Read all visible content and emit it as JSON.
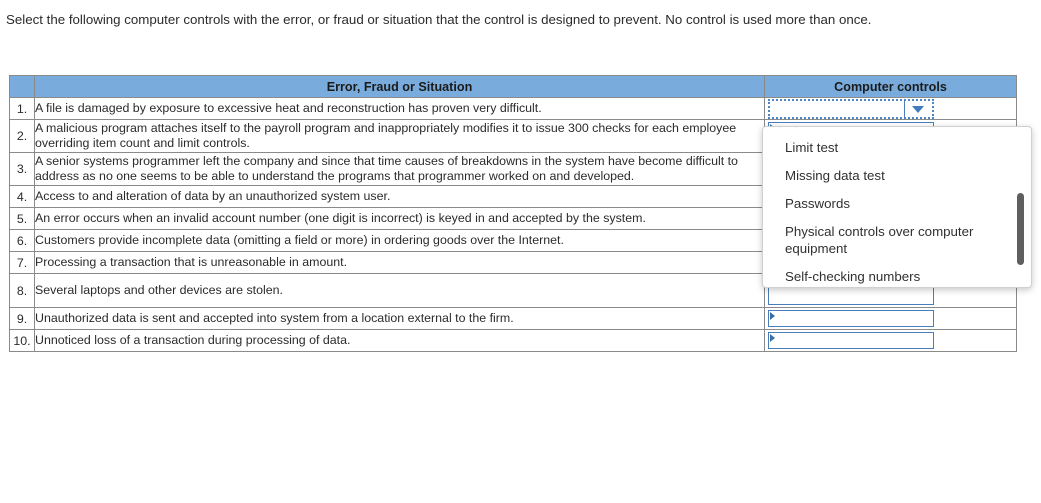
{
  "prompt": {
    "text": "Select the following computer controls with the error, or fraud or situation that the control is designed to prevent. No control is used more than once."
  },
  "table": {
    "headers": {
      "number": "",
      "situation": "Error, Fraud or Situation",
      "controls": "Computer controls"
    },
    "rows": [
      {
        "num": "1.",
        "situation": "A file is damaged by exposure to excessive heat and reconstruction has proven very difficult.",
        "control_value": ""
      },
      {
        "num": "2.",
        "situation": "A malicious program attaches itself to the payroll program and inappropriately modifies it to issue 300 checks for each employee overriding item count and limit controls.",
        "control_value": ""
      },
      {
        "num": "3.",
        "situation": "A senior systems programmer left the company and since that time causes of breakdowns in the system have become difficult to address as no one seems to be able to understand the programs that programmer worked on and developed.",
        "control_value": ""
      },
      {
        "num": "4.",
        "situation": "Access to and alteration of data by an unauthorized system user.",
        "control_value": ""
      },
      {
        "num": "5.",
        "situation": "An error occurs when an invalid account number (one digit is incorrect) is keyed in and accepted by the system.",
        "control_value": ""
      },
      {
        "num": "6.",
        "situation": "Customers provide incomplete data (omitting a field or more) in ordering goods over the Internet.",
        "control_value": ""
      },
      {
        "num": "7.",
        "situation": "Processing a transaction that is unreasonable in amount.",
        "control_value": ""
      },
      {
        "num": "8.",
        "situation": "Several laptops and other devices are stolen.",
        "control_value": ""
      },
      {
        "num": "9.",
        "situation": "Unauthorized data is sent and accepted into system from a location external to the firm.",
        "control_value": ""
      },
      {
        "num": "10.",
        "situation": "Unnoticed loss of a transaction during processing of data.",
        "control_value": ""
      }
    ]
  },
  "dropdown": {
    "open_for_row": "1.",
    "options": [
      "Limit test",
      "Missing data test",
      "Passwords",
      "Physical controls over computer equipment",
      "Self-checking numbers"
    ]
  },
  "colors": {
    "header_blue": "#79ACDC",
    "select_border": "#4a7EBB",
    "focus_dotted": "#4a86c8",
    "scroll_thumb": "#5f5f5f"
  }
}
